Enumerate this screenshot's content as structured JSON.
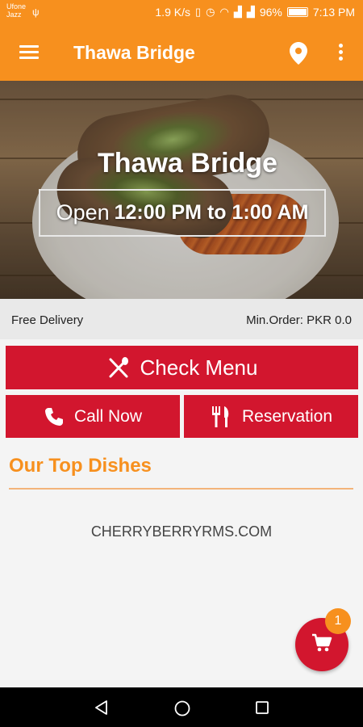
{
  "status_bar": {
    "carrier_line1": "Ufone",
    "carrier_line2": "Jazz",
    "speed": "1.9 K/s",
    "battery": "96%",
    "time": "7:13 PM"
  },
  "app_bar": {
    "title": "Thawa Bridge",
    "icons": [
      "menu-icon",
      "location-pin-icon",
      "more-vert-icon"
    ]
  },
  "hero": {
    "restaurant_name": "Thawa Bridge",
    "hours_prefix": "Open",
    "hours_range": "12:00 PM to 1:00 AM"
  },
  "info": {
    "free_delivery": "Free Delivery",
    "min_order": "Min.Order: PKR 0.0"
  },
  "buttons": {
    "check_menu": "Check Menu",
    "call_now": "Call Now",
    "reservation": "Reservation"
  },
  "top_dishes": {
    "title": "Our Top Dishes",
    "site": "CHERRYBERRYRMS.COM"
  },
  "cart": {
    "badge_count": "1",
    "icon": "cart-icon"
  },
  "colors": {
    "primary": "#f7901e",
    "accent": "#d2162e"
  }
}
